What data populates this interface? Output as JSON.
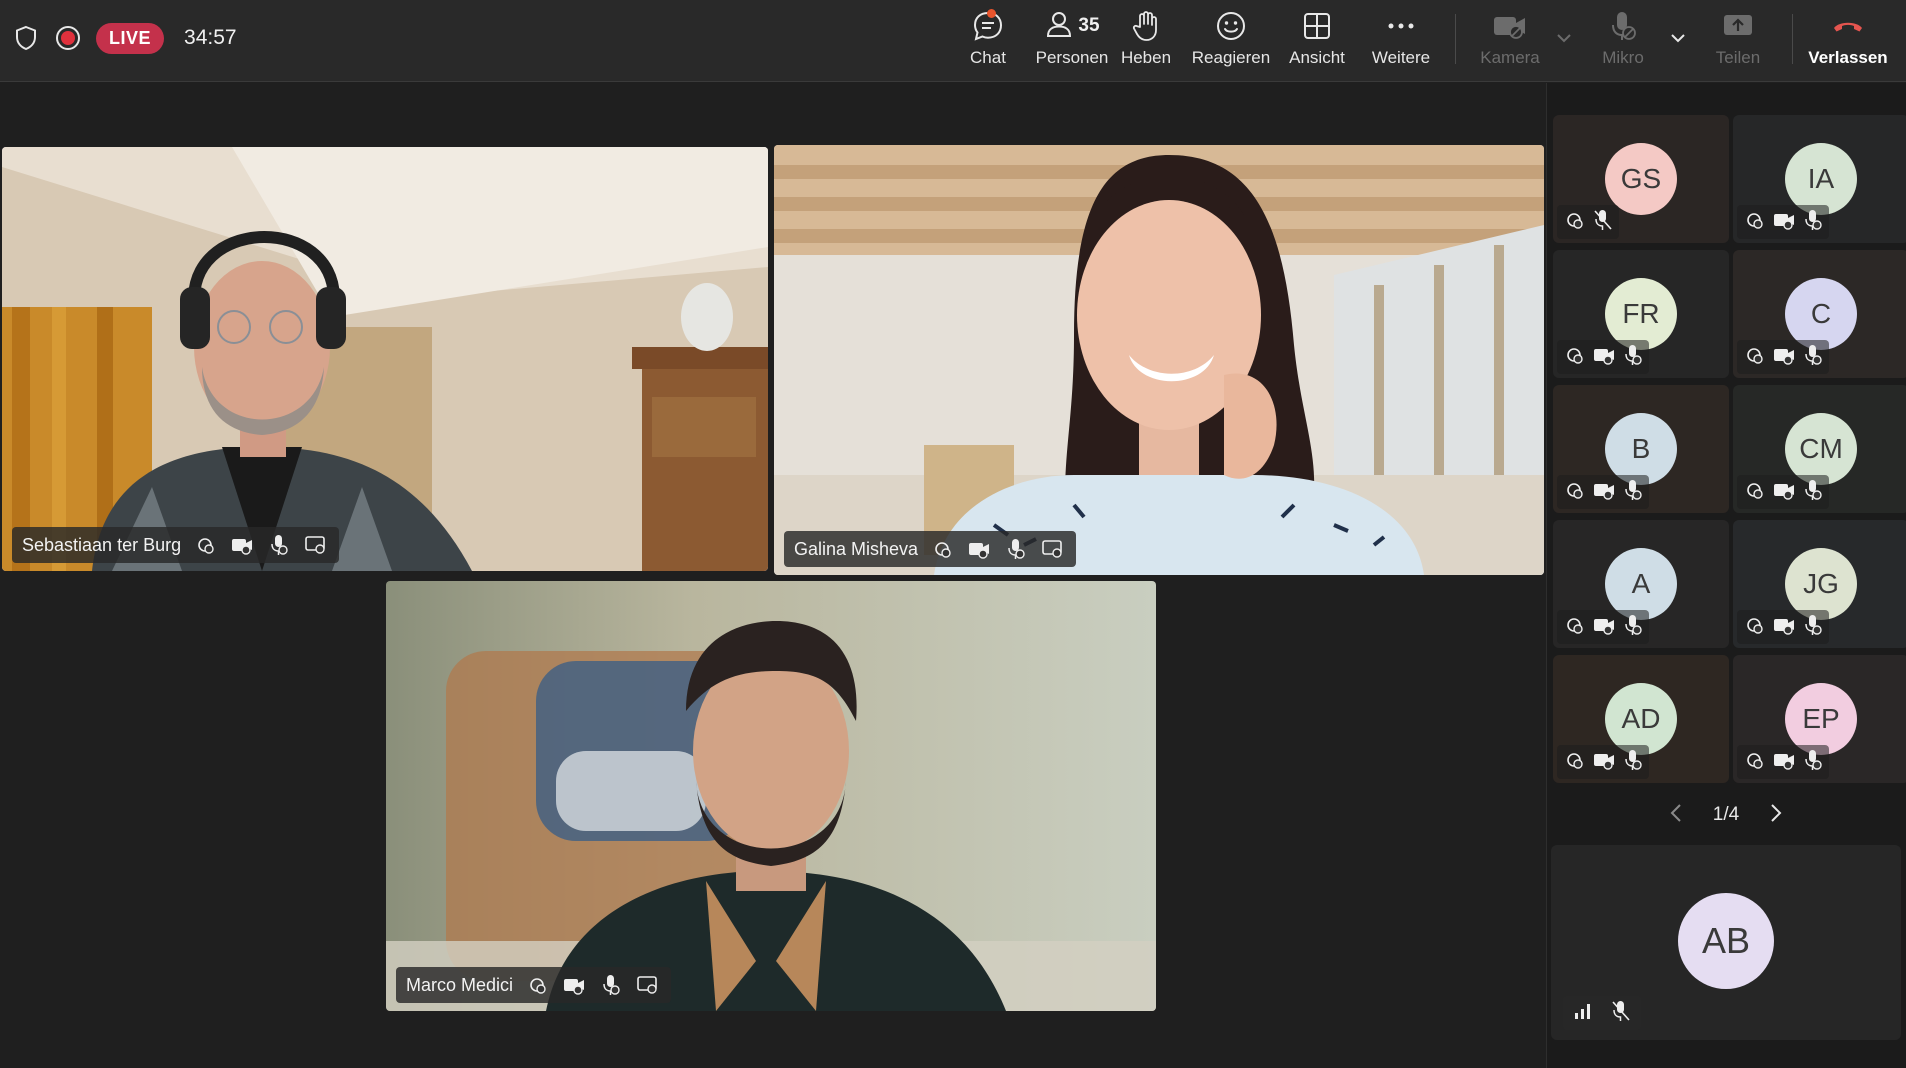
{
  "top_bar": {
    "live_label": "LIVE",
    "timer": "34:57",
    "buttons": {
      "chat": "Chat",
      "people": "Personen",
      "people_count": "35",
      "raise": "Heben",
      "react": "Reagieren",
      "view": "Ansicht",
      "more": "Weitere",
      "camera": "Kamera",
      "mic": "Mikro",
      "share": "Teilen",
      "leave": "Verlassen"
    }
  },
  "stage": {
    "tiles": [
      {
        "name": "Sebastiaan ter Burg",
        "active": true
      },
      {
        "name": "Galina Misheva",
        "active": false
      },
      {
        "name": "Marco Medici",
        "active": false
      }
    ]
  },
  "panel": {
    "participants": [
      {
        "initials": "GS",
        "color": "#f4c9c5"
      },
      {
        "initials": "IA",
        "color": "#d6e4d3"
      },
      {
        "initials": "FR",
        "color": "#e3ecd3"
      },
      {
        "initials": "C",
        "color": "#d6d6f0"
      },
      {
        "initials": "B",
        "color": "#cfdde6"
      },
      {
        "initials": "CM",
        "color": "#d6e4d3"
      },
      {
        "initials": "A",
        "color": "#cfdde6"
      },
      {
        "initials": "JG",
        "color": "#dde3d0"
      },
      {
        "initials": "AD",
        "color": "#d1e5d1"
      },
      {
        "initials": "EP",
        "color": "#f2cde0"
      }
    ],
    "pager": "1/4",
    "self": {
      "initials": "AB",
      "color": "#e5ddf2"
    }
  },
  "colors": {
    "live": "#c4314b",
    "accent": "#7f85f5",
    "leave": "#e5554f",
    "notification": "#e8542c"
  }
}
